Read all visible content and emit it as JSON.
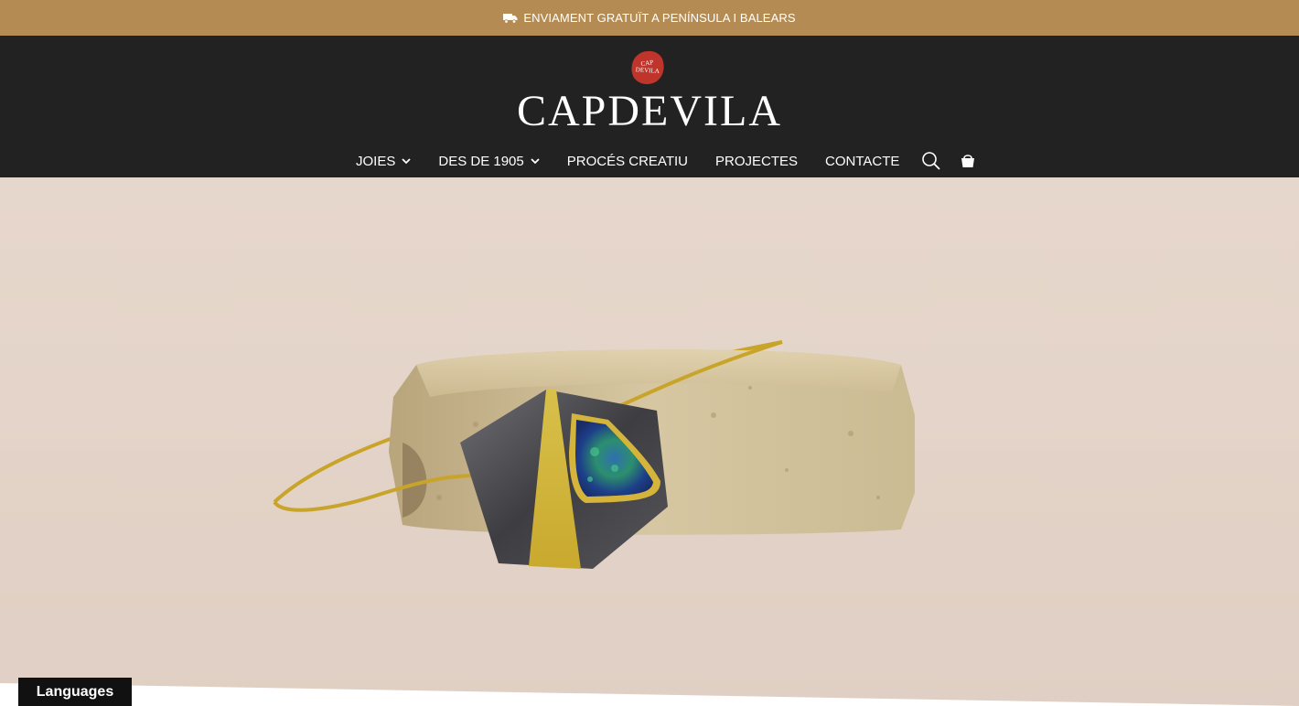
{
  "announcement": {
    "icon": "truck-icon",
    "text": "ENVIAMENT GRATUÏT A PENÍNSULA I BALEARS"
  },
  "header": {
    "seal_icon": "capdevila-seal-logo",
    "seal_text": "CAPDEVILA",
    "brand": "CAPDEVILA"
  },
  "nav": {
    "items": [
      {
        "label": "JOIES",
        "has_dropdown": true
      },
      {
        "label": "DES DE 1905",
        "has_dropdown": true
      },
      {
        "label": "PROCÉS CREATIU",
        "has_dropdown": false
      },
      {
        "label": "PROJECTES",
        "has_dropdown": false
      },
      {
        "label": "CONTACTE",
        "has_dropdown": false
      }
    ],
    "search_icon": "search-icon",
    "cart_icon": "shopping-bag-icon"
  },
  "hero": {
    "image": "jewelry-pendant-on-stone"
  },
  "languages": {
    "label": "Languages"
  },
  "colors": {
    "topbar": "#b48c53",
    "header": "#222222",
    "seal": "#c0352b"
  }
}
